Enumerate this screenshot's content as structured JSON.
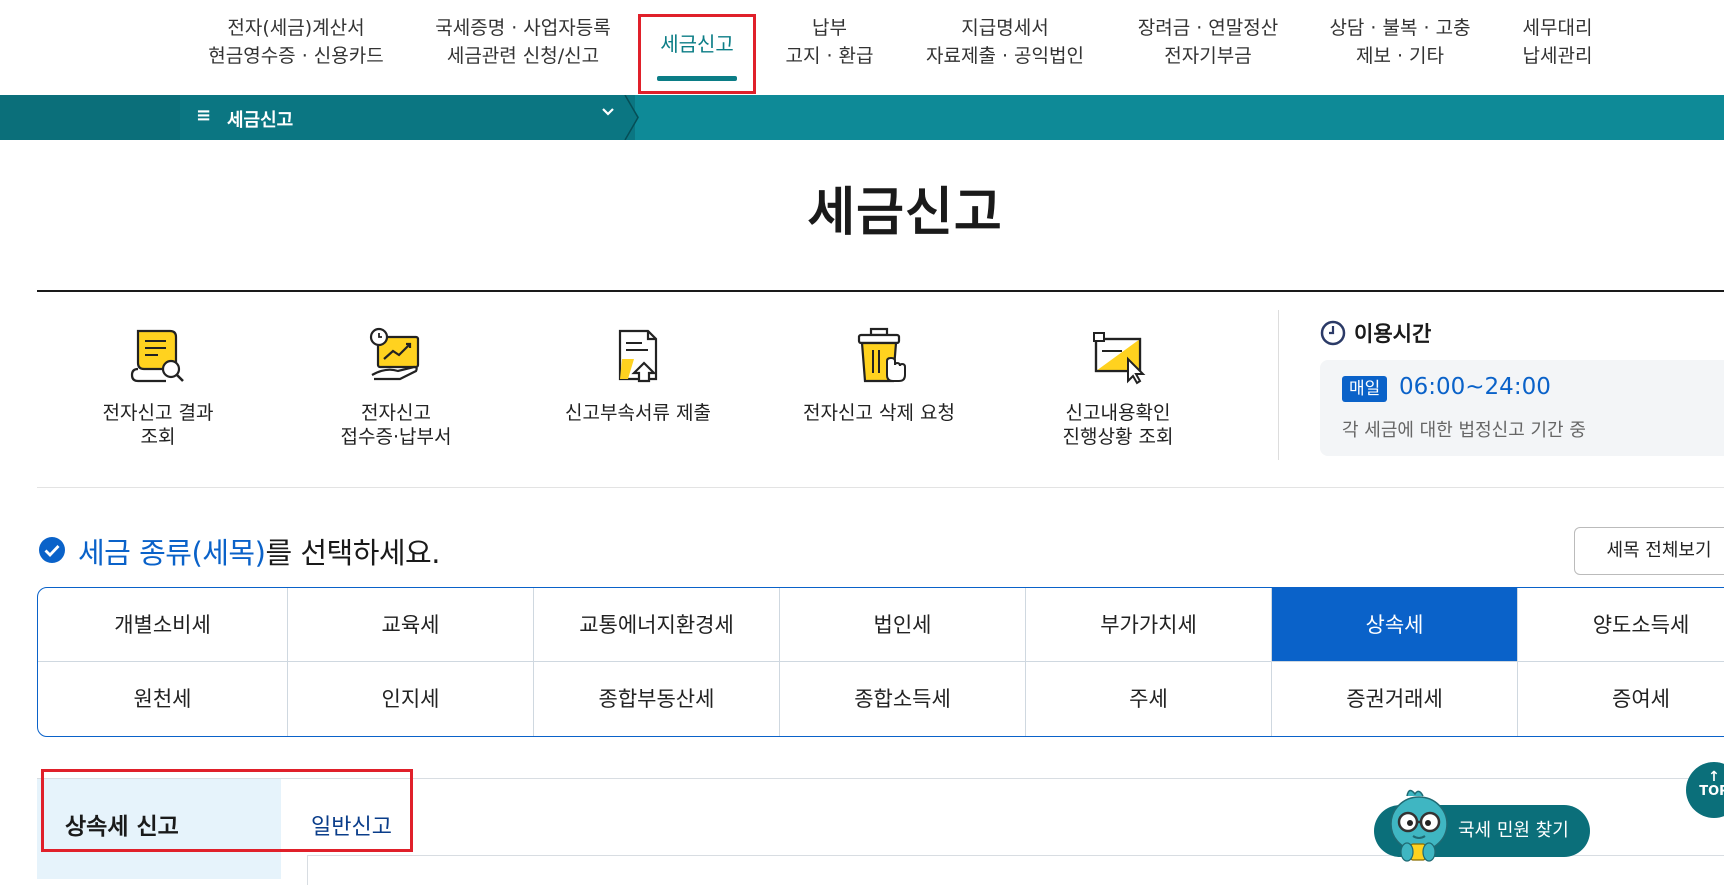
{
  "nav": {
    "items": [
      {
        "line1": "전자(세금)계산서",
        "line2": "현금영수증 · 신용카드"
      },
      {
        "line1": "국세증명 · 사업자등록",
        "line2": "세금관련 신청/신고"
      },
      {
        "line1": "납부",
        "line2": "고지 · 환급"
      },
      {
        "line1": "지급명세서",
        "line2": "자료제출 · 공익법인"
      },
      {
        "line1": "장려금 · 연말정산",
        "line2": "전자기부금"
      },
      {
        "line1": "상담 · 불복 · 고충",
        "line2": "제보 · 기타"
      },
      {
        "line1": "세무대리",
        "line2": "납세관리"
      }
    ],
    "active_label": "세금신고"
  },
  "breadcrumb": {
    "menu_icon": "≡",
    "label": "세금신고",
    "chevron": "⌄"
  },
  "page": {
    "title": "세금신고"
  },
  "quick_links": [
    {
      "icon": "document-search-icon",
      "line1": "전자신고 결과",
      "line2": "조회"
    },
    {
      "icon": "chart-hand-icon",
      "line1": "전자신고",
      "line2": "접수증·납부서"
    },
    {
      "icon": "document-upload-icon",
      "line1": "신고부속서류 제출",
      "line2": ""
    },
    {
      "icon": "trash-click-icon",
      "line1": "전자신고 삭제 요청",
      "line2": ""
    },
    {
      "icon": "screen-cursor-icon",
      "line1": "신고내용확인",
      "line2": "진행상황 조회"
    }
  ],
  "hours": {
    "title": "이용시간",
    "badge": "매일",
    "time": "06:00~24:00",
    "note": "각 세금에 대한 법정신고 기간 중"
  },
  "tax_select": {
    "heading_highlight": "세금 종류(세목)",
    "heading_rest": "를 선택하세요.",
    "view_all": "세목 전체보기",
    "row1": [
      "개별소비세",
      "교육세",
      "교통에너지환경세",
      "법인세",
      "부가가치세",
      "상속세",
      "양도소득세"
    ],
    "row2": [
      "원천세",
      "인지세",
      "종합부동산세",
      "종합소득세",
      "주세",
      "증권거래세",
      "증여세"
    ],
    "active": "상속세"
  },
  "bottom": {
    "left_label": "상속세 신고",
    "tab_label": "일반신고"
  },
  "floating": {
    "minwon_label": "국세 민원 찾기",
    "top_arrow": "↑",
    "top_label": "TOP"
  },
  "colors": {
    "teal": "#0e8a97",
    "teal_dark": "#0b7682",
    "blue": "#0a62c9",
    "highlight_red": "#e0202a"
  }
}
